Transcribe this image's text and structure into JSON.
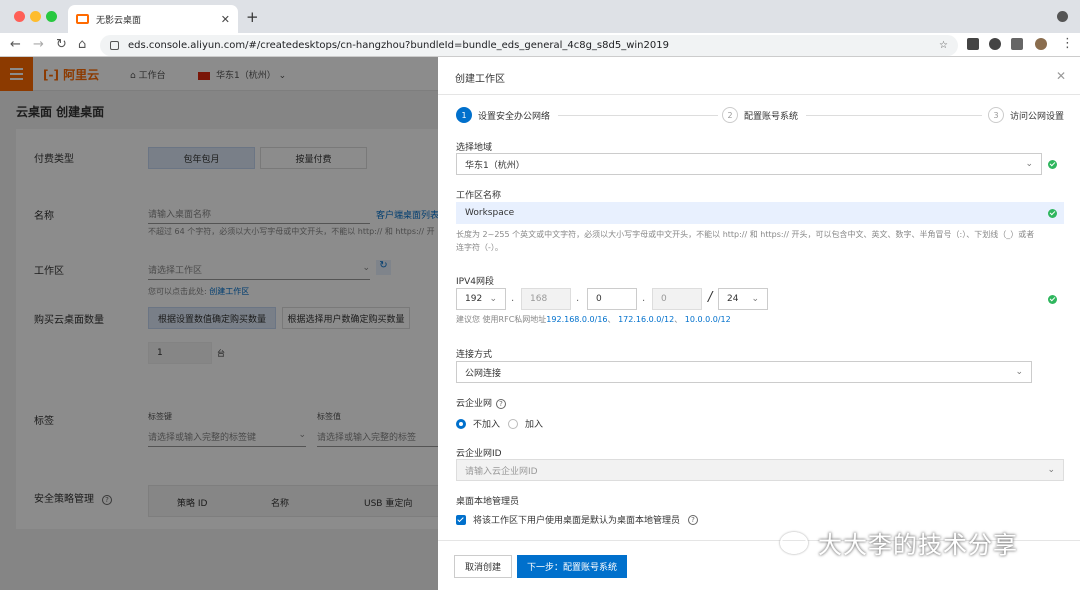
{
  "browser": {
    "tab_title": "无影云桌面",
    "url": "eds.console.aliyun.com/#/createdesktops/cn-hangzhou?bundleId=bundle_eds_general_4c8g_s8d5_win2019"
  },
  "console": {
    "logo": "阿里云",
    "workbench": "工作台",
    "region": "华东1（杭州）",
    "page_title": "云桌面 创建桌面",
    "billing_label": "付费类型",
    "billing_opt1": "包年包月",
    "billing_opt2": "按量付费",
    "name_label": "名称",
    "name_placeholder": "请输入桌面名称",
    "client_list": "客户端桌面列表",
    "name_help": "不超过 64 个字符，必须以大小写字母或中文开头，不能以 http:// 和 https:// 开",
    "workspace_label": "工作区",
    "workspace_placeholder": "请选择工作区",
    "workspace_help": "您可以点击此处:",
    "workspace_link": "创建工作区",
    "count_label": "购买云桌面数量",
    "count_opt1": "根据设置数值确定购买数量",
    "count_opt2": "根据选择用户数确定购买数量",
    "count_value": "1",
    "count_unit": "台",
    "tag_label": "标签",
    "tag_key_label": "标签键",
    "tag_key_placeholder": "请选择或输入完整的标签键",
    "tag_value_label": "标签值",
    "tag_value_placeholder": "请选择或输入完整的标签",
    "policy_label": "安全策略管理",
    "policy_cols": [
      "策略 ID",
      "名称",
      "USB 重定向"
    ]
  },
  "drawer": {
    "title": "创建工作区",
    "steps": [
      {
        "num": "1",
        "label": "设置安全办公网络"
      },
      {
        "num": "2",
        "label": "配置账号系统"
      },
      {
        "num": "3",
        "label": "访问公网设置"
      }
    ],
    "region_label": "选择地域",
    "region_value": "华东1（杭州）",
    "ws_name_label": "工作区名称",
    "ws_name_value": "Workspace",
    "ws_name_help1": "长度为 2~255 个英文或中文字符，必须以大小写字母或中文开头，不能以 http:// 和 https:// 开头，可以包含中文、英文、数字、半角冒号（:）、下划线（_）或者",
    "ws_name_help2": "连字符（-）。",
    "ipv4_label": "IPV4网段",
    "ip1": "192",
    "ip2": "168",
    "ip3": "0",
    "ip4": "0",
    "mask": "24",
    "ip_help_prefix": "建议您 使用RFC私网地址",
    "ip_sugg1": "192.168.0.0/16",
    "ip_sugg2": "172.16.0.0/12",
    "ip_sugg3": "10.0.0.0/12",
    "conn_label": "连接方式",
    "conn_value": "公网连接",
    "cen_label": "云企业网",
    "cen_opt1": "不加入",
    "cen_opt2": "加入",
    "cen_id_label": "云企业网ID",
    "cen_id_placeholder": "请输入云企业网ID",
    "admin_label": "桌面本地管理员",
    "admin_check": "将该工作区下用户使用桌面是默认为桌面本地管理员",
    "cancel": "取消创建",
    "next": "下一步：配置账号系统"
  },
  "watermark": "大大李的技术分享"
}
